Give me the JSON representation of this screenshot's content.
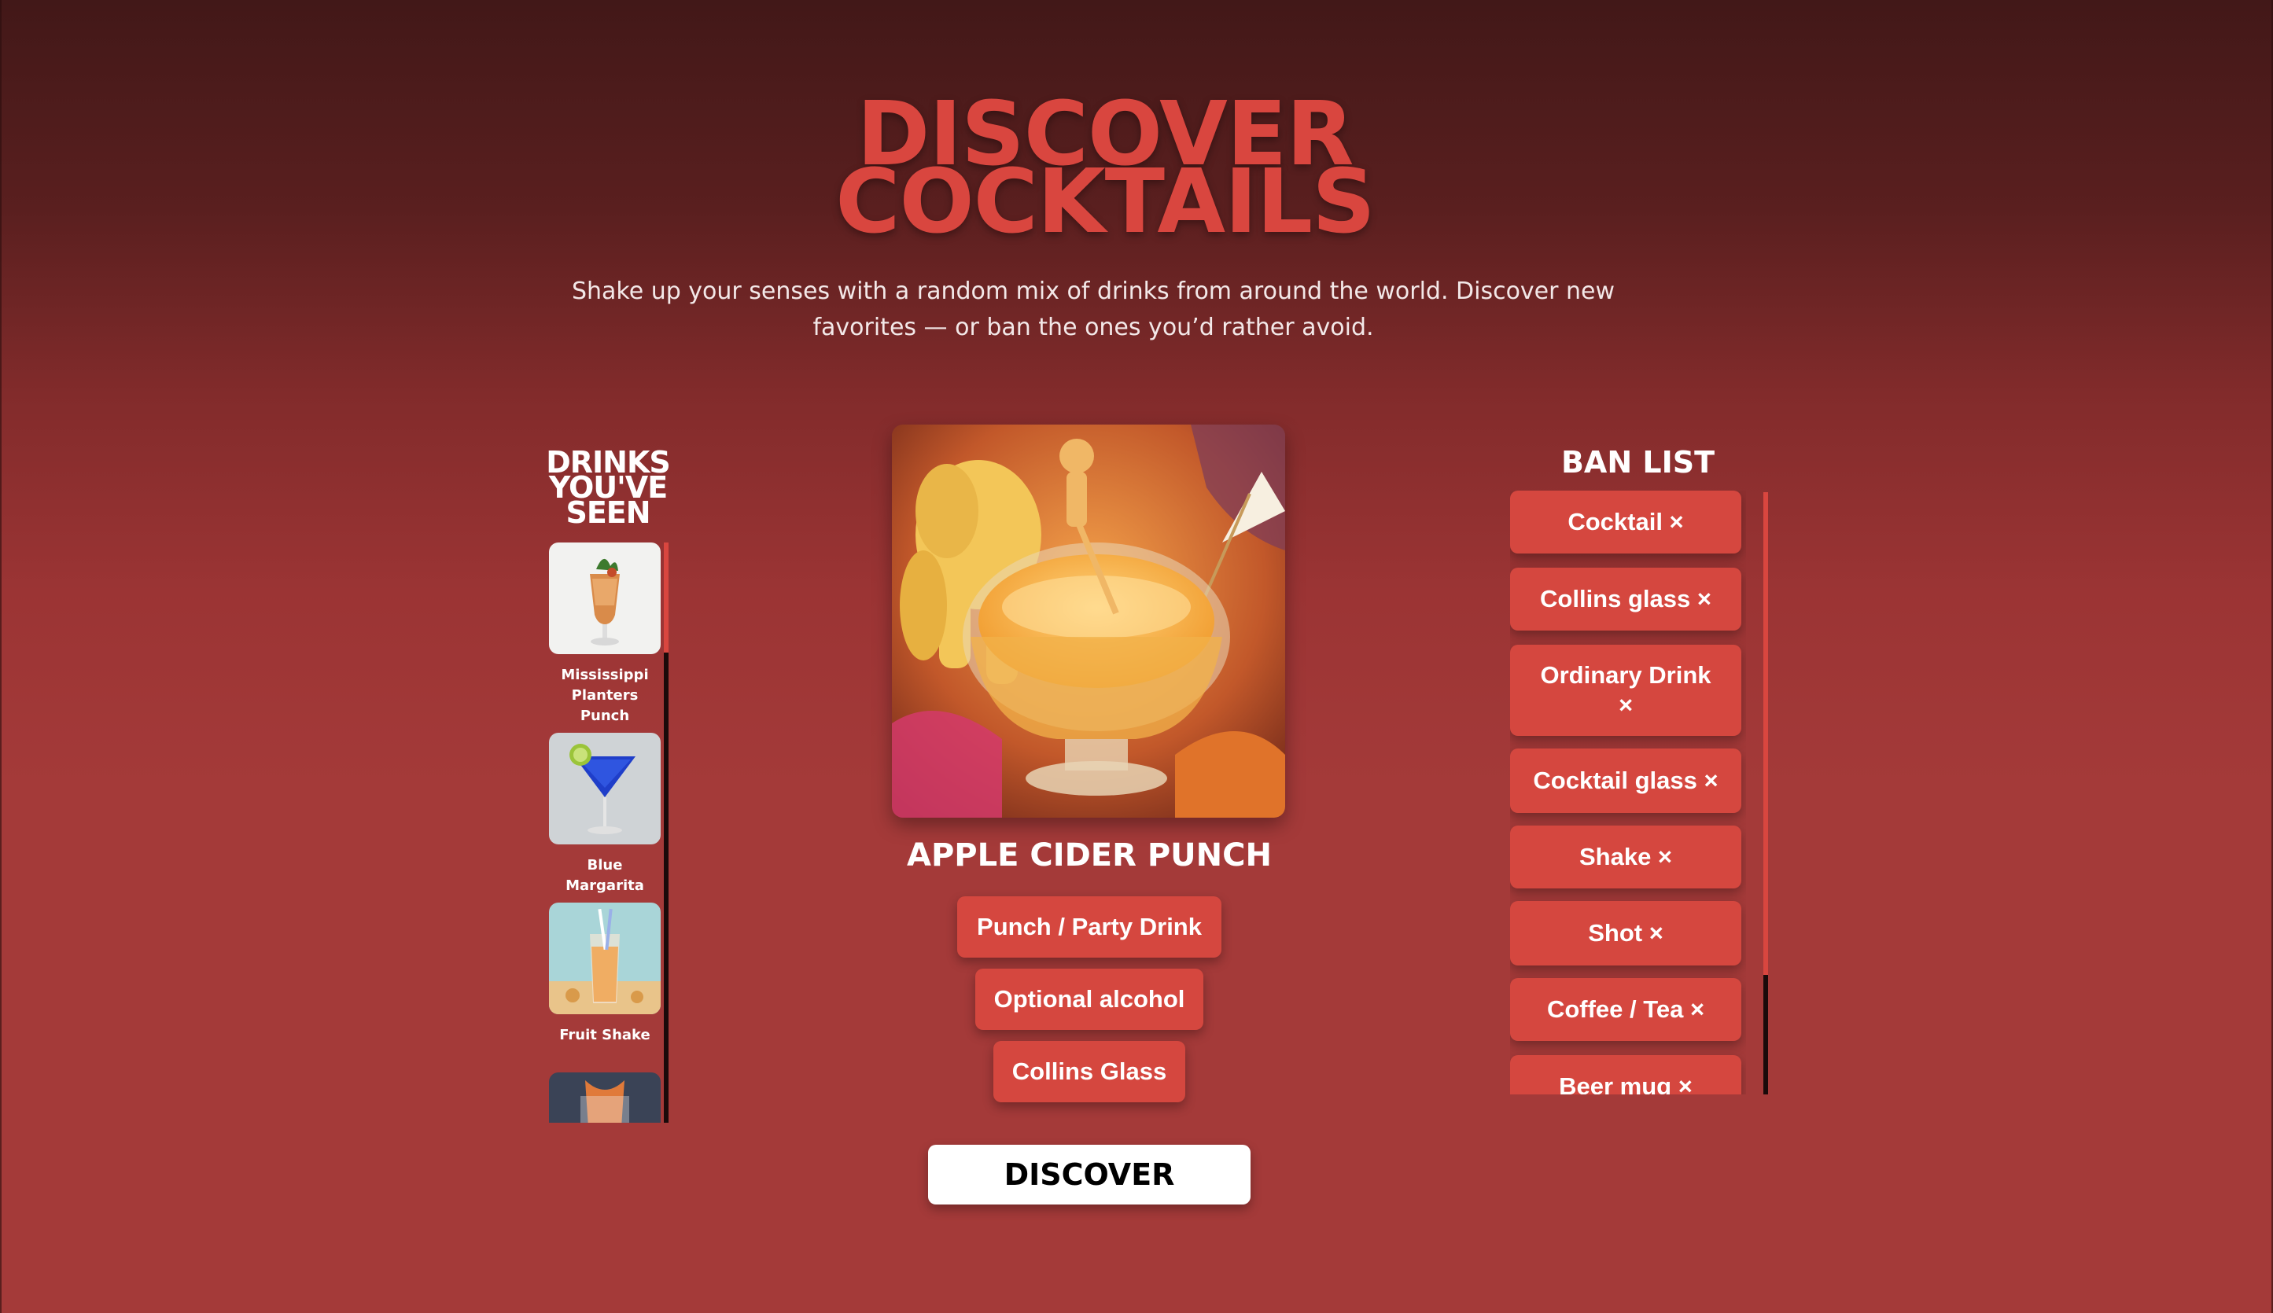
{
  "header": {
    "title_line1": "DISCOVER",
    "title_line2": "COCKTAILS",
    "subtitle": "Shake up your senses with a random mix of drinks from around the world. Discover new favorites — or ban the ones you’d rather avoid."
  },
  "seen": {
    "heading_line1": "DRINKS",
    "heading_line2": "YOU'VE",
    "heading_line3": "SEEN",
    "items": [
      {
        "name": "Mississippi Planters Punch"
      },
      {
        "name": "Blue Margarita"
      },
      {
        "name": "Fruit Shake"
      },
      {
        "name": ""
      }
    ]
  },
  "current": {
    "name": "APPLE CIDER PUNCH",
    "tags": [
      "Punch / Party Drink",
      "Optional alcohol",
      "Collins Glass"
    ],
    "discover_label": "DISCOVER"
  },
  "ban": {
    "heading": "BAN LIST",
    "items": [
      "Cocktail ×",
      "Collins glass ×",
      "Ordinary Drink ×",
      "Cocktail glass ×",
      "Shake ×",
      "Shot ×",
      "Coffee / Tea ×",
      "Beer mug ×"
    ]
  }
}
